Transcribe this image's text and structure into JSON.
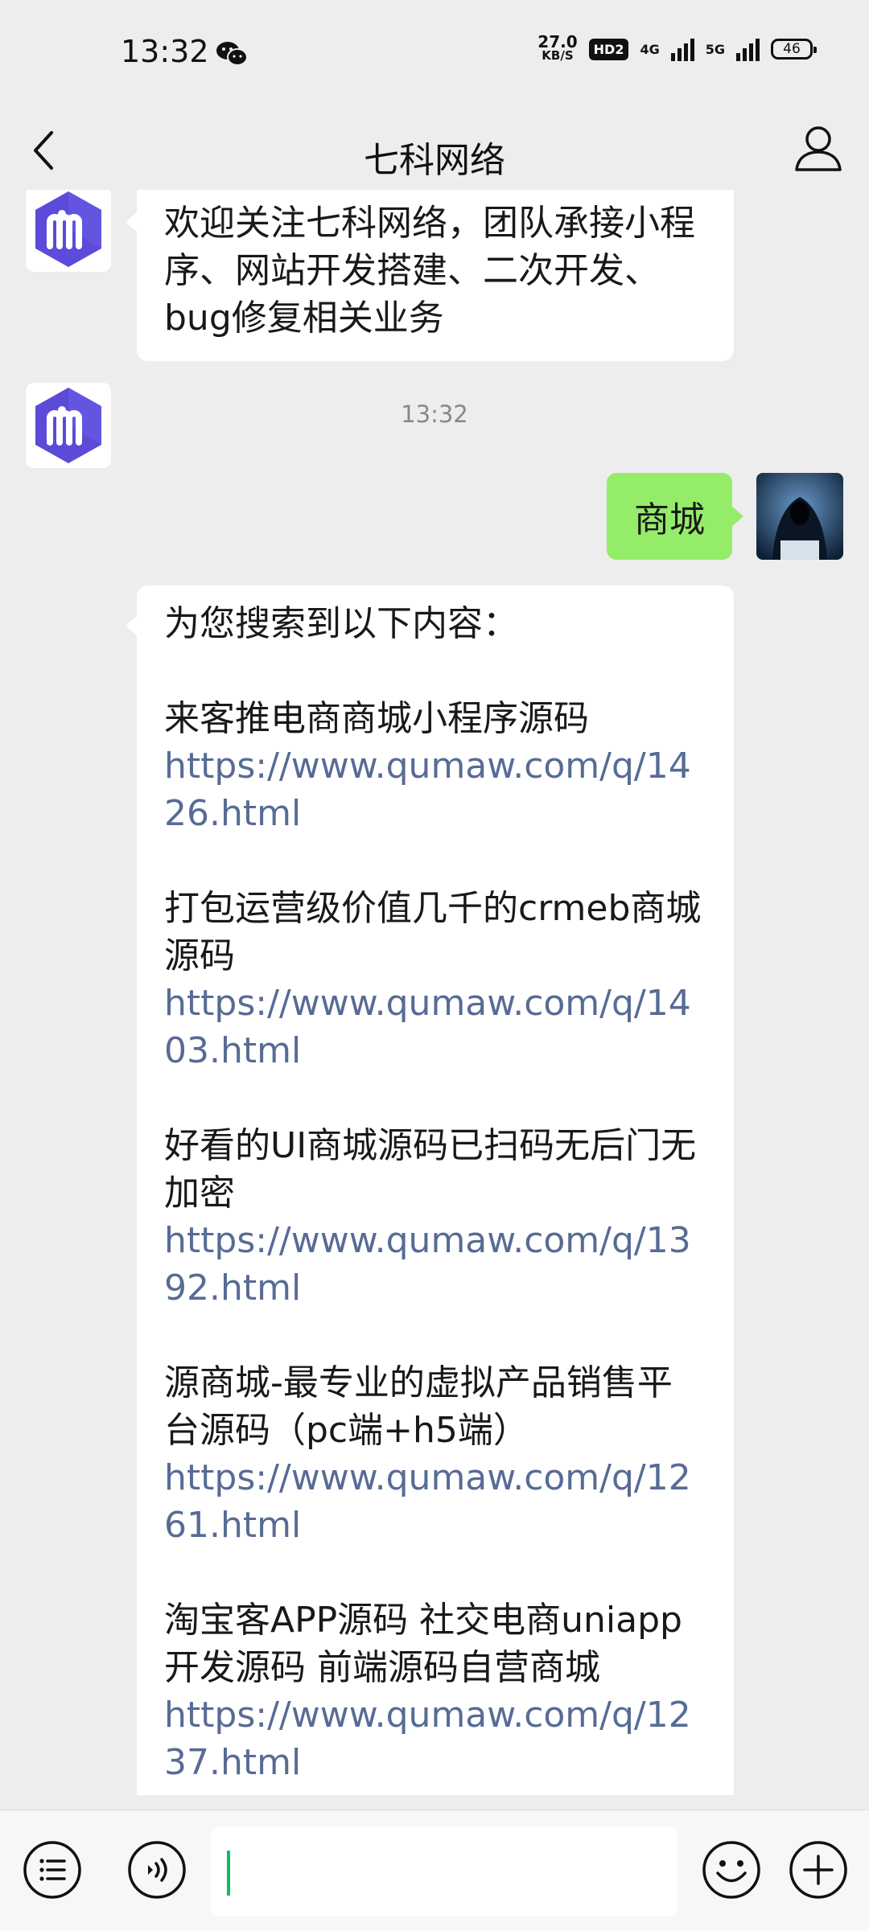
{
  "status_bar": {
    "time": "13:32",
    "net_speed_value": "27.0",
    "net_speed_unit": "KB/S",
    "hd_badge": "HD2",
    "net_4g": "4G",
    "net_5g": "5G",
    "battery": "46"
  },
  "nav": {
    "title": "七科网络"
  },
  "messages": {
    "welcome": "欢迎关注七科网络，团队承接小程序、网站开发搭建、二次开发、bug修复相关业务",
    "timestamp": "13:32",
    "user_query": "商城",
    "reply_intro": "为您搜索到以下内容：",
    "results": [
      {
        "title": "来客推电商商城小程序源码",
        "url": "https://www.qumaw.com/q/1426.html"
      },
      {
        "title": "打包运营级价值几千的crmeb商城源码",
        "url": "https://www.qumaw.com/q/1403.html"
      },
      {
        "title": "好看的UI商城源码已扫码无后门无加密",
        "url": "https://www.qumaw.com/q/1392.html"
      },
      {
        "title": "源商城-最专业的虚拟产品销售平台源码（pc端+h5端）",
        "url": "https://www.qumaw.com/q/1261.html"
      },
      {
        "title": "淘宝客APP源码 社交电商uniapp开发源码 前端源码自营商城",
        "url": "https://www.qumaw.com/q/1237.html"
      }
    ]
  },
  "colors": {
    "sent_bubble": "#95ec69",
    "link": "#576b95",
    "logo_purple": "#5b4bd8"
  },
  "icons": [
    "wechat-icon",
    "back-icon",
    "profile-icon",
    "menu-icon",
    "voice-icon",
    "emoji-icon",
    "plus-icon"
  ]
}
